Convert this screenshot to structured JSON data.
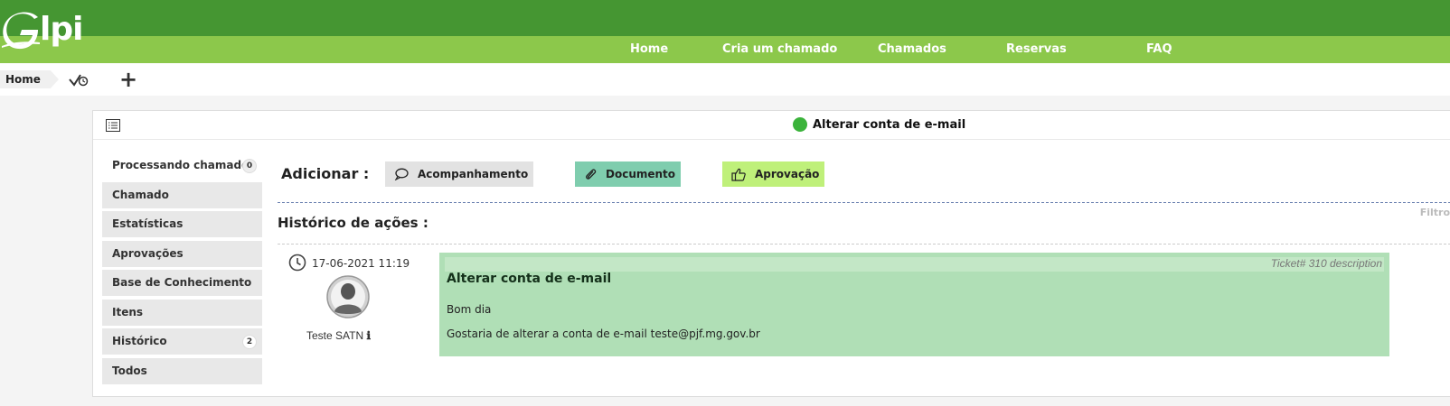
{
  "header": {
    "logo_text": "lpi",
    "nav": [
      "Home",
      "Cria um chamado",
      "Chamados",
      "Reservas",
      "FAQ"
    ]
  },
  "breadcrumb": {
    "home": "Home",
    "check_icon": "check-clock-icon",
    "add_icon": "plus-icon",
    "add_glyph": "+"
  },
  "ticket": {
    "title": "Alterar conta de e-mail",
    "status_color": "#3bb33b"
  },
  "tabs": [
    {
      "label": "Processando chamado",
      "badge": "0"
    },
    {
      "label": "Chamado"
    },
    {
      "label": "Estatísticas"
    },
    {
      "label": "Aprovações"
    },
    {
      "label": "Base de Conhecimento"
    },
    {
      "label": "Itens"
    },
    {
      "label": "Histórico",
      "badge": "2"
    },
    {
      "label": "Todos"
    }
  ],
  "actions": {
    "add_label": "Adicionar :",
    "followup": "Acompanhamento",
    "document": "Documento",
    "approval": "Aprovação"
  },
  "history": {
    "title": "Histórico de ações :",
    "filter": "Filtro"
  },
  "entry": {
    "date": "17-06-2021 11:19",
    "author": "Teste SATN",
    "author_info_glyph": "ℹ",
    "ref": "Ticket# 310 description",
    "title": "Alterar conta de e-mail",
    "line1": "Bom dia",
    "line2": "Gostaria de alterar a conta de e-mail teste@pjf.mg.gov.br"
  },
  "colors": {
    "header_dark": "#459632",
    "header_light": "#8cc84b",
    "document_btn": "#7fcdae",
    "approval_btn": "#bff07a",
    "followup_btn": "#e2e2e2",
    "description_bg": "#b0dfb6"
  }
}
